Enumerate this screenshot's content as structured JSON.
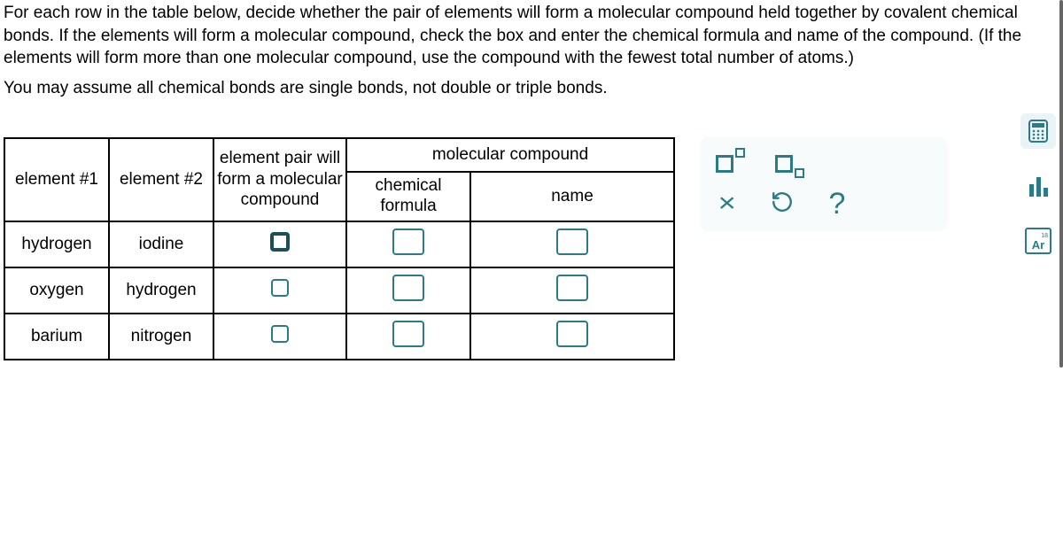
{
  "instructions": {
    "p1": "For each row in the table below, decide whether the pair of elements will form a molecular compound held together by covalent chemical bonds. If the elements will form a molecular compound, check the box and enter the chemical formula and name of the compound. (If the elements will form more than one molecular compound, use the compound with the fewest total number of atoms.)",
    "p2": "You may assume all chemical bonds are single bonds, not double or triple bonds."
  },
  "headers": {
    "e1": "element #1",
    "e2": "element #2",
    "pair": "element pair will form a molecular compound",
    "mol": "molecular compound",
    "formula": "chemical formula",
    "name": "name"
  },
  "rows": [
    {
      "e1": "hydrogen",
      "e2": "iodine",
      "heavy": true
    },
    {
      "e1": "oxygen",
      "e2": "hydrogen",
      "heavy": false
    },
    {
      "e1": "barium",
      "e2": "nitrogen",
      "heavy": false
    }
  ],
  "toolpanel": {
    "clear": "×",
    "reset": "↺",
    "help": "?"
  },
  "pt": {
    "num": "18",
    "sym": "Ar"
  }
}
